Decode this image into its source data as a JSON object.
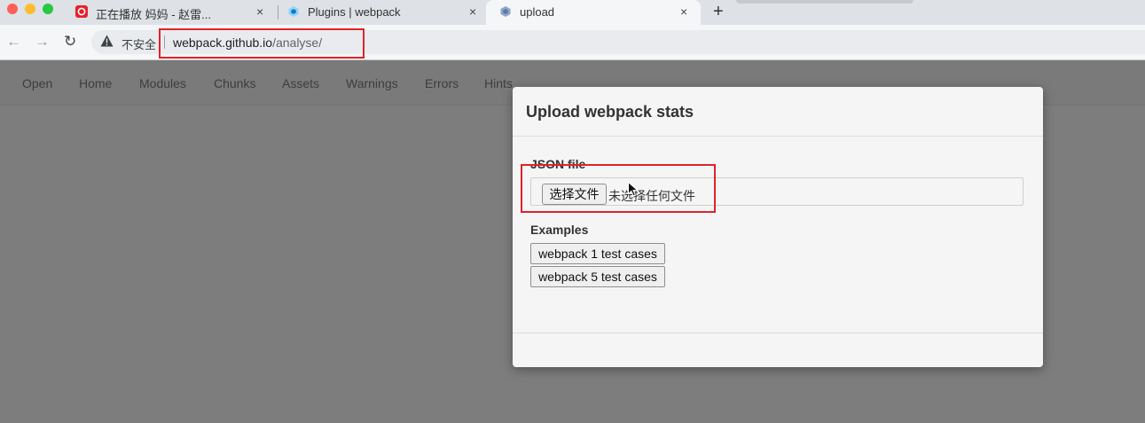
{
  "browser": {
    "tabs": [
      {
        "title": "正在播放 妈妈 - 赵雷..."
      },
      {
        "title": "Plugins | webpack"
      },
      {
        "title": "upload"
      }
    ],
    "close_glyph": "×",
    "new_tab_glyph": "+",
    "nav": {
      "back_glyph": "←",
      "forward_glyph": "→",
      "reload_glyph": "↻"
    },
    "security_label": "不安全",
    "url_host": "webpack.github.io",
    "url_path": "/analyse/"
  },
  "app_nav": [
    "Open",
    "Home",
    "Modules",
    "Chunks",
    "Assets",
    "Warnings",
    "Errors",
    "Hints"
  ],
  "modal": {
    "title": "Upload webpack stats",
    "json_file_label": "JSON file",
    "file_button": "选择文件",
    "file_status": "未选择任何文件",
    "examples_label": "Examples",
    "example_buttons": [
      "webpack 1 test cases",
      "webpack 5 test cases"
    ]
  },
  "colors": {
    "highlight": "#e1222b",
    "traffic_red": "#fe5f57",
    "traffic_yellow": "#febc2e",
    "traffic_green": "#28c840"
  }
}
